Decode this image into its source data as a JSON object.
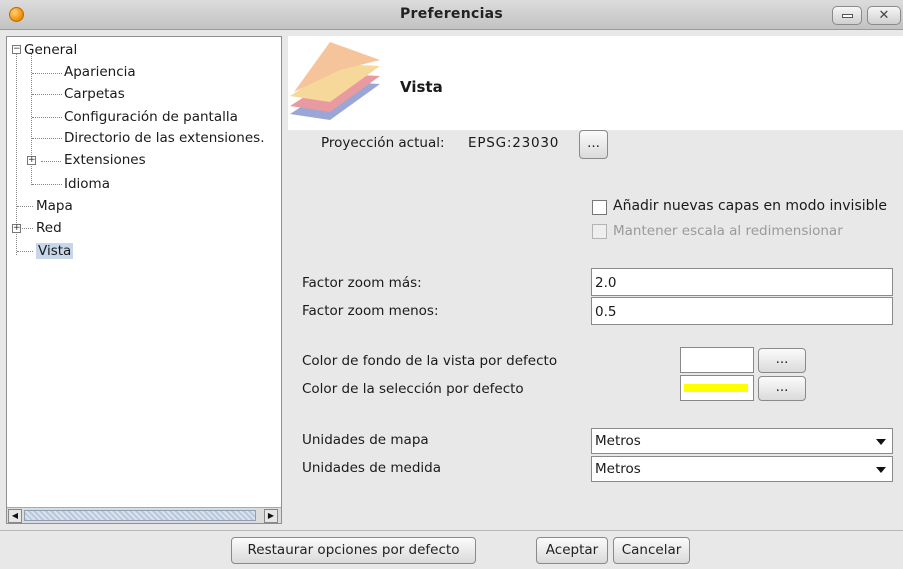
{
  "window": {
    "title": "Preferencias"
  },
  "tree": {
    "general": "General",
    "apariencia": "Apariencia",
    "carpetas": "Carpetas",
    "configuracion": "Configuración de pantalla",
    "directorio": "Directorio de las extensiones.",
    "extensiones": "Extensiones",
    "idioma": "Idioma",
    "mapa": "Mapa",
    "red": "Red",
    "vista": "Vista"
  },
  "panel": {
    "title": "Vista",
    "projection_label": "Proyección actual:",
    "projection_value": "EPSG:23030",
    "projection_button": "...",
    "add_layers_invisible": "Añadir nuevas capas en modo invisible",
    "keep_scale": "Mantener escala al redimensionar",
    "zoom_in_label": "Factor zoom más:",
    "zoom_in_value": "2.0",
    "zoom_out_label": "Factor zoom menos:",
    "zoom_out_value": "0.5",
    "bg_color_label": "Color de fondo de la vista por defecto",
    "bg_color_button": "...",
    "bg_color": "#ffffff",
    "sel_color_label": "Color de la selección por defecto",
    "sel_color_button": "...",
    "sel_color": "#ffff00",
    "map_units_label": "Unidades de mapa",
    "map_units_value": "Metros",
    "measure_units_label": "Unidades de medida",
    "measure_units_value": "Metros"
  },
  "footer": {
    "restore": "Restaurar opciones por defecto",
    "accept": "Aceptar",
    "cancel": "Cancelar"
  }
}
